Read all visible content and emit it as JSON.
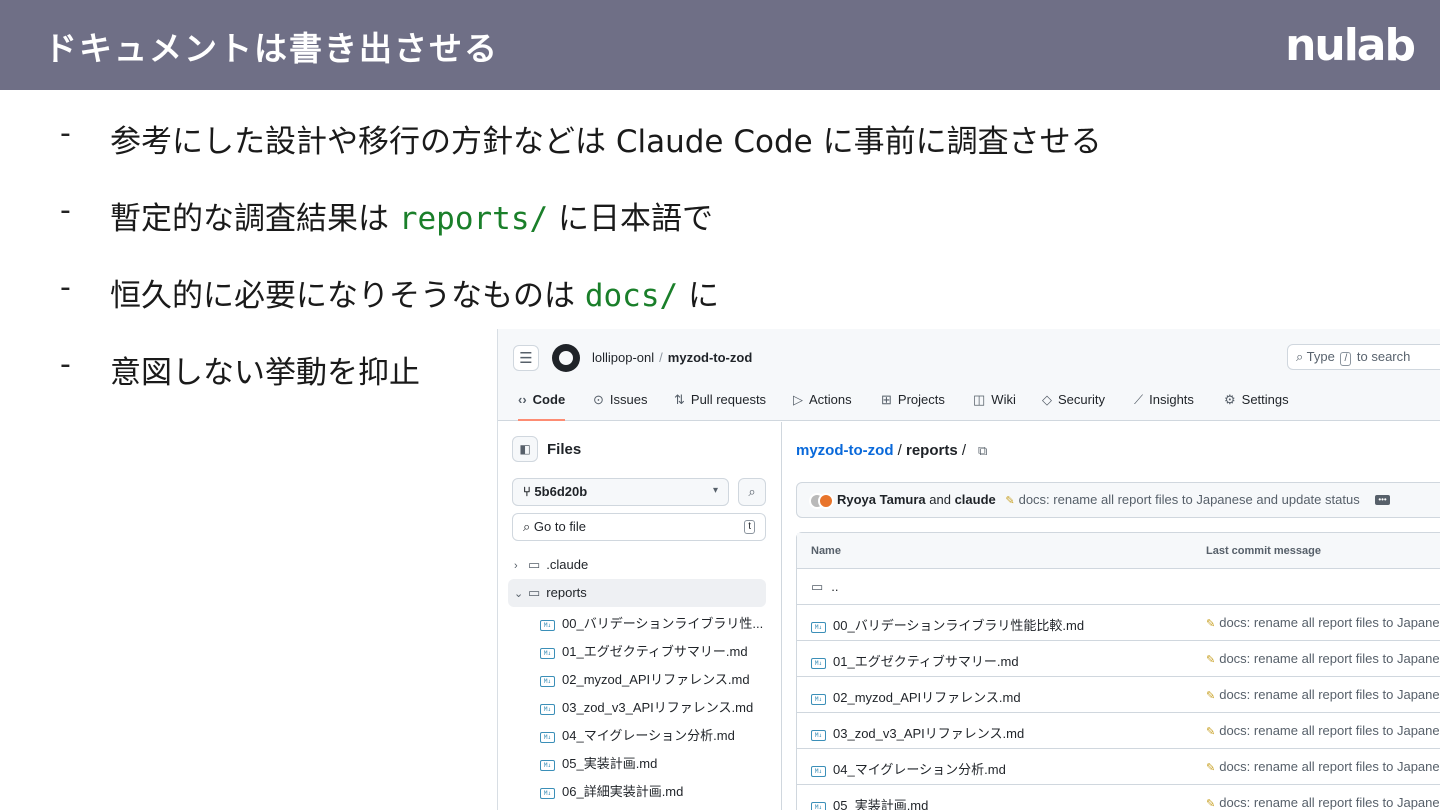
{
  "slide": {
    "title": "ドキュメントは書き出させる",
    "logo": "nulab"
  },
  "bullets": [
    {
      "dash": "-",
      "text": "参考にした設計や移行の方針などは Claude Code に事前に調査させる"
    },
    {
      "dash": "-",
      "text_before": "暫定的な調査結果は ",
      "code": "reports/",
      "text_after": " に日本語で"
    },
    {
      "dash": "-",
      "text_before": "恒久的に必要になりそうなものは ",
      "code": "docs/",
      "text_after": " に"
    },
    {
      "dash": "-",
      "text": "意図しない挙動を抑止"
    }
  ],
  "github": {
    "owner": "lollipop-onl",
    "separator": "/",
    "repo": "myzod-to-zod",
    "search": {
      "before": "Type",
      "key": "/",
      "after": "to search"
    },
    "tabs": [
      {
        "icon": "‹›",
        "label": "Code"
      },
      {
        "icon": "⊙",
        "label": "Issues"
      },
      {
        "icon": "⇅",
        "label": "Pull requests"
      },
      {
        "icon": "▷",
        "label": "Actions"
      },
      {
        "icon": "⊞",
        "label": "Projects"
      },
      {
        "icon": "◫",
        "label": "Wiki"
      },
      {
        "icon": "◇",
        "label": "Security"
      },
      {
        "icon": "⟋",
        "label": "Insights"
      },
      {
        "icon": "⚙",
        "label": "Settings"
      }
    ],
    "sidebar": {
      "title": "Files",
      "branch": "5b6d20b",
      "goto_placeholder": "Go to file",
      "goto_key": "t",
      "folders": [
        {
          "chev": "›",
          "label": ".claude"
        },
        {
          "chev": "⌄",
          "label": "reports"
        }
      ],
      "files": [
        "00_バリデーションライブラリ性...",
        "01_エグゼクティブサマリー.md",
        "02_myzod_APIリファレンス.md",
        "03_zod_v3_APIリファレンス.md",
        "04_マイグレーション分析.md",
        "05_実装計画.md",
        "06_詳細実装計画.md"
      ]
    },
    "main": {
      "breadcrumb_repo": "myzod-to-zod",
      "breadcrumb_sep": " / ",
      "breadcrumb_current": "reports",
      "breadcrumb_tail": " /",
      "commit": {
        "author1": "Ryoya Tamura",
        "and": " and ",
        "author2": "claude",
        "message": "docs: rename all report files to Japanese and update status",
        "more": "•••"
      },
      "table": {
        "col_name": "Name",
        "col_message": "Last commit message",
        "parent": "..",
        "rows": [
          {
            "name": "00_バリデーションライブラリ性能比較.md",
            "message": "docs: rename all report files to Japanes"
          },
          {
            "name": "01_エグゼクティブサマリー.md",
            "message": "docs: rename all report files to Japanes"
          },
          {
            "name": "02_myzod_APIリファレンス.md",
            "message": "docs: rename all report files to Japanes"
          },
          {
            "name": "03_zod_v3_APIリファレンス.md",
            "message": "docs: rename all report files to Japanes"
          },
          {
            "name": "04_マイグレーション分析.md",
            "message": "docs: rename all report files to Japanes"
          },
          {
            "name": "05_実装計画.md",
            "message": "docs: rename all report files to Japanes"
          }
        ]
      }
    }
  }
}
